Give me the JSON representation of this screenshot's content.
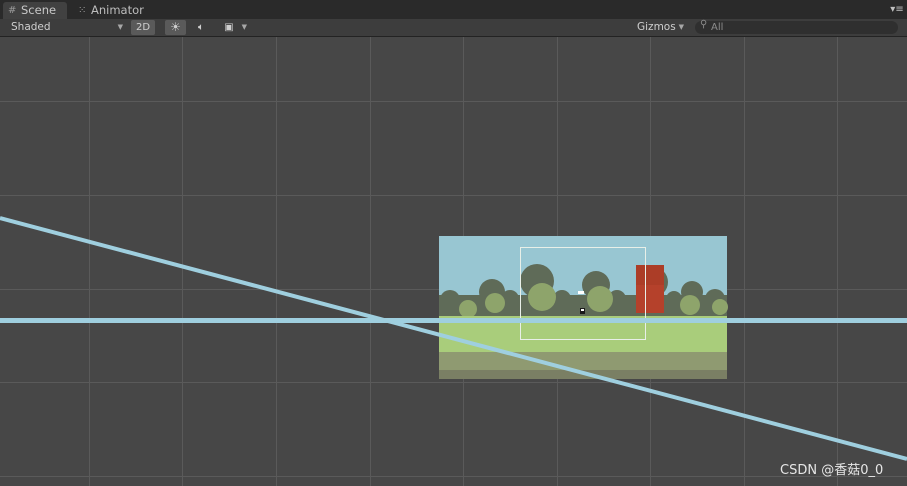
{
  "tabs": [
    {
      "label": "Scene",
      "icon": "scene-grid-icon",
      "active": true
    },
    {
      "label": "Animator",
      "icon": "animator-icon",
      "active": false
    }
  ],
  "toolbar": {
    "shading_mode": "Shaded",
    "mode_2d_label": "2D",
    "lighting_icon": "sun-icon",
    "audio_icon": "speaker-icon",
    "effects_icon": "image-icon",
    "gizmos_label": "Gizmos",
    "search_placeholder": "All"
  },
  "scene": {
    "grid_color": "#5a5a5a",
    "sky_color": "#98c6d2",
    "ground_color": "#a9cd7b",
    "line_color": "#9fcfdf",
    "enemy_color": "#b5412b"
  },
  "watermark": "CSDN @香菇0_0"
}
